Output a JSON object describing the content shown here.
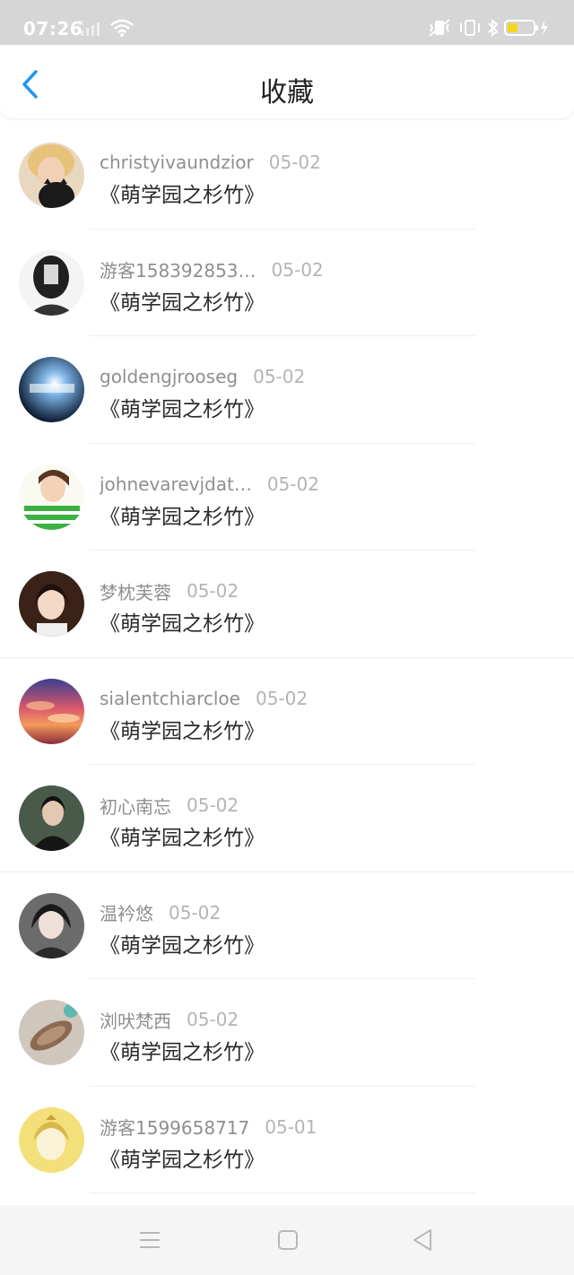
{
  "status_bar": {
    "time": "07:26"
  },
  "header": {
    "title": "收藏"
  },
  "items": [
    {
      "user": "christyivaundzior",
      "date": "05-02",
      "title": "《萌学园之杉竹》"
    },
    {
      "user": "游客158392853…",
      "date": "05-02",
      "title": "《萌学园之杉竹》"
    },
    {
      "user": "goldengjrooseg",
      "date": "05-02",
      "title": "《萌学园之杉竹》"
    },
    {
      "user": "johnevarevjdat…",
      "date": "05-02",
      "title": "《萌学园之杉竹》"
    },
    {
      "user": "梦枕芙蓉",
      "date": "05-02",
      "title": "《萌学园之杉竹》"
    },
    {
      "user": "sialentchiarcloe",
      "date": "05-02",
      "title": "《萌学园之杉竹》"
    },
    {
      "user": "初心南忘",
      "date": "05-02",
      "title": "《萌学园之杉竹》"
    },
    {
      "user": "温衿悠",
      "date": "05-02",
      "title": "《萌学园之杉竹》"
    },
    {
      "user": "浏吠梵西",
      "date": "05-02",
      "title": "《萌学园之杉竹》"
    },
    {
      "user": "游客1599658717",
      "date": "05-01",
      "title": "《萌学园之杉竹》"
    }
  ],
  "colors": {
    "accent": "#2196f3",
    "status_bar_bg": "#d6d6d6",
    "username": "#8f8f8f",
    "date": "#b4b4b4"
  },
  "icons": {
    "back": "chevron-left-icon",
    "nav_menu": "menu-icon",
    "nav_home": "square-icon",
    "nav_back": "triangle-back-icon"
  }
}
